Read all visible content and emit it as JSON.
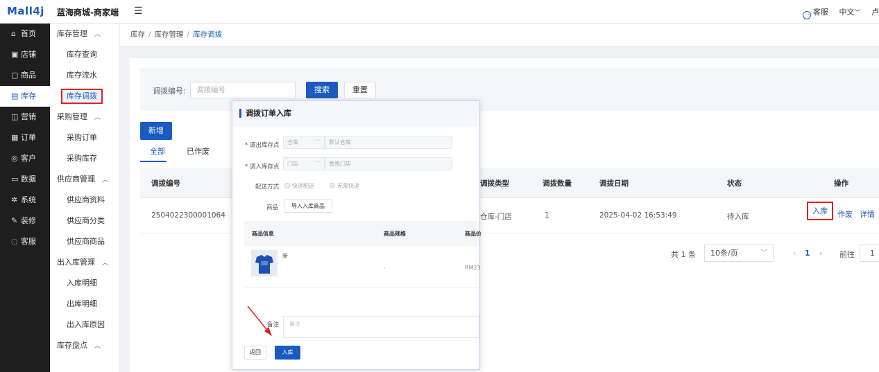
{
  "header": {
    "logo": "Mall4j",
    "shop_name": "蓝海商城-商家端",
    "menu_toggle_icon": "☰",
    "customer_service": "客服",
    "language": "中文",
    "extra": "卢"
  },
  "nav_primary": [
    {
      "icon": "home-icon",
      "glyph": "⌂",
      "label": "首页"
    },
    {
      "icon": "store-icon",
      "glyph": "▣",
      "label": "店铺"
    },
    {
      "icon": "goods-icon",
      "glyph": "▢",
      "label": "商品"
    },
    {
      "icon": "stock-icon",
      "glyph": "▤",
      "label": "库存",
      "active": true
    },
    {
      "icon": "gift-icon",
      "glyph": "◫",
      "label": "营销"
    },
    {
      "icon": "order-icon",
      "glyph": "▦",
      "label": "订单"
    },
    {
      "icon": "users-icon",
      "glyph": "◎",
      "label": "客户"
    },
    {
      "icon": "chart-icon",
      "glyph": "▭",
      "label": "数据"
    },
    {
      "icon": "settings-icon",
      "glyph": "✲",
      "label": "系统"
    },
    {
      "icon": "decorate-icon",
      "glyph": "✎",
      "label": "装修"
    },
    {
      "icon": "chat-icon",
      "glyph": "◌",
      "label": "客服"
    }
  ],
  "nav_secondary": [
    {
      "type": "group",
      "label": "库存管理",
      "chevron": "︿"
    },
    {
      "type": "sub",
      "label": "库存查询"
    },
    {
      "type": "sub",
      "label": "库存流水"
    },
    {
      "type": "sub",
      "label": "库存调拨",
      "active": true
    },
    {
      "type": "group",
      "label": "采购管理",
      "chevron": "︿"
    },
    {
      "type": "sub",
      "label": "采购订单"
    },
    {
      "type": "sub",
      "label": "采购库存"
    },
    {
      "type": "group",
      "label": "供应商管理",
      "chevron": "︿"
    },
    {
      "type": "sub",
      "label": "供应商资料"
    },
    {
      "type": "sub",
      "label": "供应商分类"
    },
    {
      "type": "sub",
      "label": "供应商商品"
    },
    {
      "type": "group",
      "label": "出入库管理",
      "chevron": "︿"
    },
    {
      "type": "sub",
      "label": "入库明细"
    },
    {
      "type": "sub",
      "label": "出库明细"
    },
    {
      "type": "sub",
      "label": "出入库原因"
    },
    {
      "type": "group",
      "label": "库存盘点",
      "chevron": "︿"
    }
  ],
  "breadcrumb": {
    "items": [
      "库存",
      "库存管理"
    ],
    "current": "库存调拨",
    "separator": "/"
  },
  "search": {
    "label": "调拨编号:",
    "placeholder": "调拨编号",
    "search_button": "搜索",
    "reset_button": "重置"
  },
  "add_button": "新增",
  "tabs": [
    "全部",
    "已作废"
  ],
  "table": {
    "headers": {
      "code": "调拨编号",
      "type": "调拨类型",
      "qty": "调拨数量",
      "date": "调拨日期",
      "status": "状态",
      "ops": "操作"
    },
    "rows": [
      {
        "code": "2504022300001064",
        "type": "仓库-门店",
        "qty": "1",
        "date": "2025-04-02 16:53:49",
        "status": "待入库",
        "op_in": "入库",
        "op_void": "作废",
        "op_detail": "详情"
      }
    ]
  },
  "pagination": {
    "total": "共 1 条",
    "page_size": "10条/页",
    "page": "1",
    "goto_label": "前往",
    "goto_value": "1"
  },
  "modal": {
    "title": "调拨订单入库",
    "out_label": "调出库存点",
    "out_type": "仓库",
    "out_value": "默认仓库",
    "in_label": "调入库存点",
    "in_type": "门店",
    "in_value": "番禺门店",
    "delivery_label": "配送方式",
    "delivery_opt1": "快递配送",
    "delivery_opt2": "无需快递",
    "goods_label": "商品",
    "import_button": "导入入库商品",
    "product_headers": {
      "info": "商品信息",
      "spec": "商品规格",
      "price": "商品价"
    },
    "product": {
      "name": "新",
      "spec": "-",
      "price": "RM23"
    },
    "note_label": "备注",
    "note_placeholder": "备注",
    "back_button": "返回",
    "confirm_button": "入库"
  },
  "colors": {
    "primary": "#1a5bbf",
    "highlight": "#e02020",
    "sidebar": "#1e1e1e"
  }
}
